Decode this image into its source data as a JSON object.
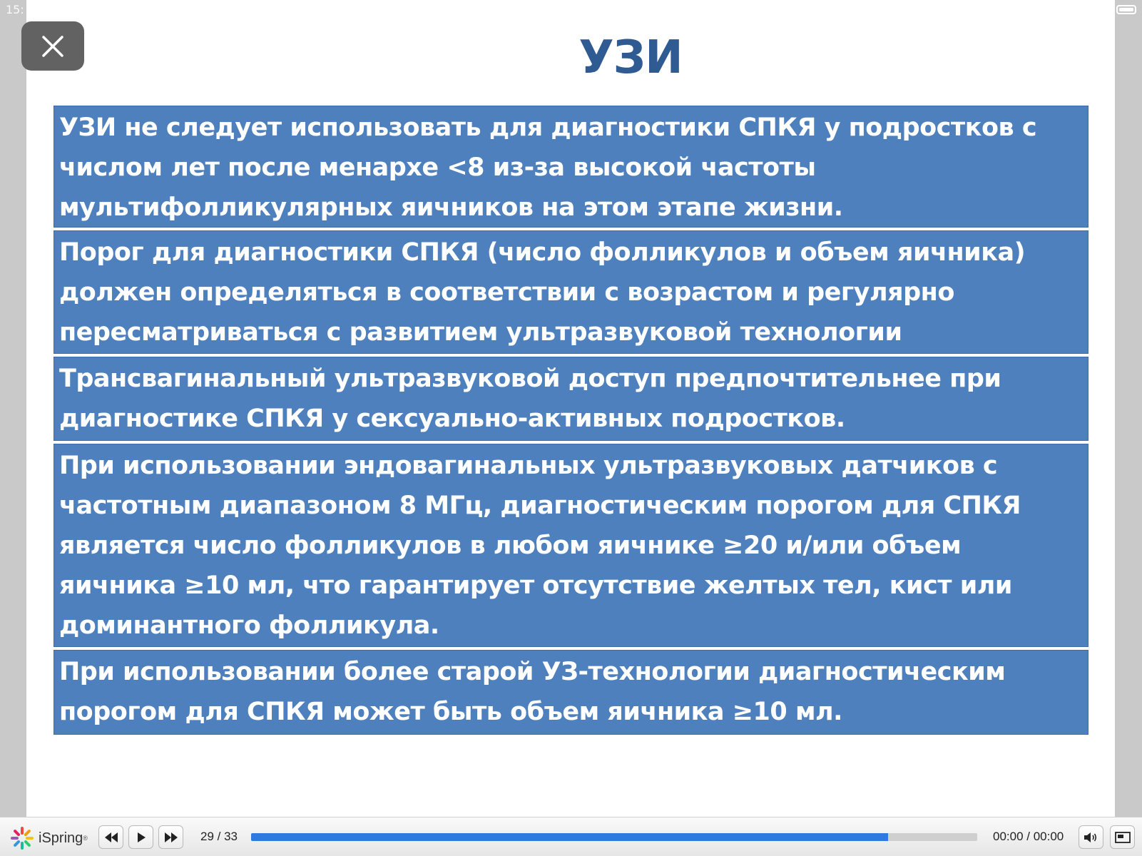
{
  "status_bar": {
    "time": "15:",
    "battery_level": 1.0
  },
  "slide": {
    "title": "УЗИ",
    "boxes": [
      {
        "lines": [
          "УЗИ не следует использовать для диагностики СПКЯ у подростков с",
          "числом лет после менархе <8 из-за высокой частоты",
          "мультифолликулярных яичников на этом этапе жизни."
        ]
      },
      {
        "lines": [
          "Порог для диагностики СПКЯ (число фолликулов и объем яичника)",
          "должен определяться в соответствии с возрастом и регулярно",
          "пересматриваться с развитием ультразвуковой технологии"
        ]
      },
      {
        "lines": [
          "Трансвагинальный ультразвуковой доступ предпочтительнее при",
          "диагностике СПКЯ у сексуально-активных подростков."
        ]
      },
      {
        "lines": [
          "При использовании эндовагинальных ультразвуковых датчиков с",
          "частотным диапазоном 8 МГц, диагностическим порогом для СПКЯ",
          "является  число фолликулов в любом яичнике ≥20 и/или объем",
          "яичника ≥10 мл, что гарантирует отсутствие желтых тел, кист или",
          "доминантного фолликула."
        ]
      },
      {
        "lines": [
          "При использовании более старой  УЗ-технологии диагностическим",
          "порогом для СПКЯ может быть объем яичника ≥10 мл."
        ]
      }
    ],
    "colors": {
      "box_fill": "#4e80bd",
      "title": "#2f5a92",
      "box_text": "#ffffff"
    }
  },
  "player": {
    "logo_text": "iSpring",
    "logo_mark": "®",
    "slide_counter": "29 / 33",
    "progress": 0.877,
    "time": "00:00 / 00:00",
    "icons": {
      "close": "close-icon",
      "previous": "rewind-icon",
      "play": "play-icon",
      "next": "fast-forward-icon",
      "volume": "volume-icon",
      "fullscreen": "fullscreen-icon"
    },
    "colors": {
      "progress_fill": "#2f79e0",
      "progress_track": "#cfcfcf"
    }
  }
}
